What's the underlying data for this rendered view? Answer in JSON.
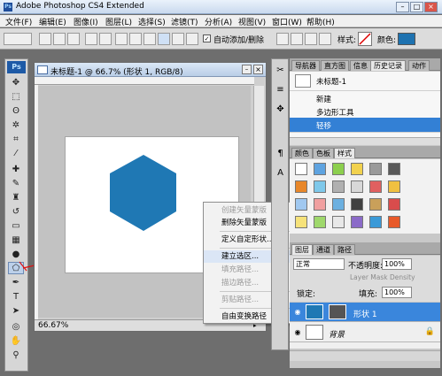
{
  "window": {
    "title": "Adobe Photoshop CS4 Extended",
    "app_badge": "Ps"
  },
  "menu": [
    "文件(F)",
    "编辑(E)",
    "图像(I)",
    "图层(L)",
    "选择(S)",
    "滤镜(T)",
    "分析(A)",
    "视图(V)",
    "窗口(W)",
    "帮助(H)"
  ],
  "options": {
    "auto_add_delete_label": "自动添加/删除",
    "auto_add_delete_checked": true,
    "style_label": "样式:",
    "color_label": "颜色:",
    "color_value": "#1e72b0"
  },
  "document": {
    "title": "未标题-1 @ 66.7% (形状 1, RGB/8)",
    "zoom_status": "66.67%",
    "shape_color": "#1f78b4"
  },
  "context_menu": {
    "items": [
      {
        "label": "创建矢量蒙版",
        "enabled": false
      },
      {
        "label": "删除矢量蒙版",
        "enabled": true
      },
      {
        "label": "定义自定形状...",
        "enabled": true
      },
      {
        "label": "建立选区...",
        "enabled": true,
        "highlighted": true
      },
      {
        "label": "填充路径...",
        "enabled": false
      },
      {
        "label": "描边路径...",
        "enabled": false
      },
      {
        "label": "剪贴路径...",
        "enabled": false
      },
      {
        "label": "自由变换路径",
        "enabled": true
      }
    ]
  },
  "history_panel": {
    "tabs": [
      "导航器",
      "直方图",
      "信息",
      "历史记录",
      "动作"
    ],
    "active_tab": "历史记录",
    "snapshot": "未标题-1",
    "items": [
      {
        "label": "新建",
        "selected": false
      },
      {
        "label": "多边形工具",
        "selected": false
      },
      {
        "label": "轻移",
        "selected": true
      }
    ]
  },
  "swatch_panel": {
    "tabs": [
      "颜色",
      "色板",
      "样式"
    ],
    "active_tab": "样式",
    "swatches": [
      "#ffffff",
      "#5ea3e0",
      "#8ccf4e",
      "#f2d24e",
      "#9a9a9a",
      "#5a5a5a",
      "#e8872a",
      "#7ec8ea",
      "#b0b0b0",
      "#d8d8d8",
      "#e06060",
      "#f0c040",
      "#a0c8f0",
      "#f0a0a0",
      "#6cb0e0",
      "#404040",
      "#c9a05a",
      "#d94c4c",
      "#f6e27a",
      "#9fd86c",
      "#e8e8e8",
      "#8b6bc8",
      "#3a9ad8",
      "#e85a2a"
    ]
  },
  "layers_panel": {
    "tabs": [
      "图层",
      "通道",
      "路径"
    ],
    "active_tab": "图层",
    "blend_mode": "正常",
    "opacity_label": "不透明度:",
    "opacity": "100%",
    "mask_density": "Layer Mask Density",
    "lock_label": "锁定:",
    "fill_label": "填充:",
    "fill": "100%",
    "layers": [
      {
        "name": "形状 1",
        "selected": true
      },
      {
        "name": "背景",
        "selected": false
      }
    ]
  }
}
